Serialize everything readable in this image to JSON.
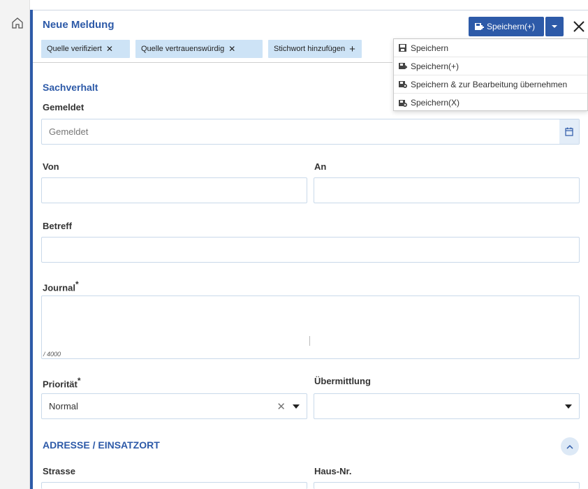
{
  "header": {
    "title": "Neue Meldung",
    "save_label": "Speichern(+)"
  },
  "chips": [
    {
      "label": "Quelle verifiziert"
    },
    {
      "label": "Quelle vertrauenswürdig"
    },
    {
      "label": "Stichwort hinzufügen"
    }
  ],
  "save_menu": {
    "items": [
      {
        "label": "Speichern"
      },
      {
        "label": "Speichern(+)"
      },
      {
        "label": "Speichern & zur Bearbeitung übernehmen"
      },
      {
        "label": "Speichern(X)"
      }
    ]
  },
  "form": {
    "section_sachverhalt": "Sachverhalt",
    "gemeldet_label": "Gemeldet",
    "gemeldet_placeholder": "Gemeldet",
    "von_label": "Von",
    "an_label": "An",
    "betreff_label": "Betreff",
    "journal_label": "Journal",
    "journal_counter": "/ 4000",
    "prioritaet_label": "Priorität",
    "prioritaet_value": "Normal",
    "uebermittlung_label": "Übermittlung",
    "uebermittlung_value": "",
    "section_adresse": "ADRESSE / EINSATZORT",
    "strasse_label": "Strasse",
    "hausnr_label": "Haus-Nr.",
    "required_marker": "*"
  },
  "colors": {
    "accent": "#2d5aa8",
    "chip_bg": "#cde3f6",
    "field_border": "#c9d9ea"
  },
  "icons": {
    "home": "home-icon",
    "save": "save-plus-icon",
    "close": "close-icon",
    "calendar": "calendar-icon",
    "collapse": "chevron-up-icon"
  }
}
